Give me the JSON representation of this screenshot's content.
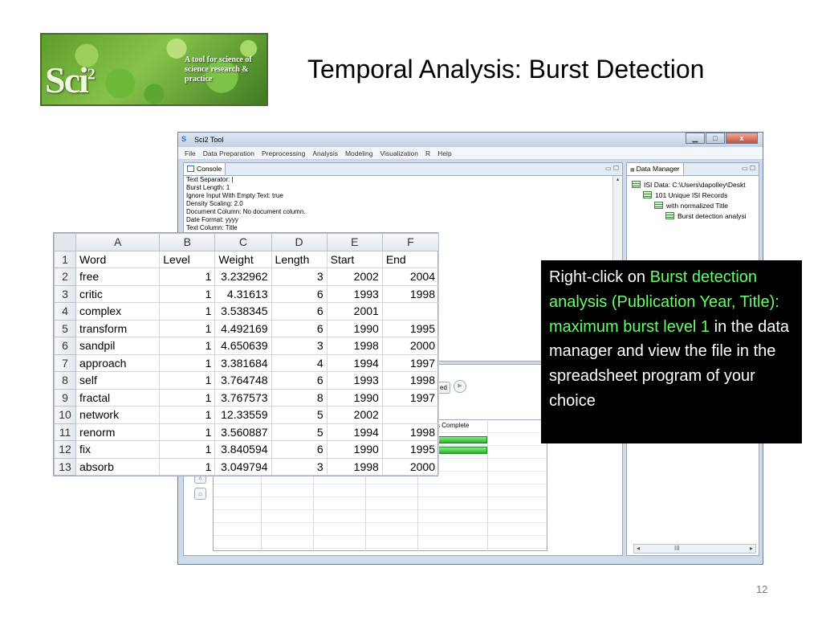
{
  "slide": {
    "title": "Temporal Analysis: Burst Detection",
    "page_number": "12"
  },
  "logo": {
    "mark": "Sci",
    "mark_sup": "2",
    "tagline": "A tool for science of science research & practice"
  },
  "window": {
    "title": "Sci2 Tool",
    "controls": [
      "▁",
      "□",
      "x"
    ],
    "menu": [
      "File",
      "Data Preparation",
      "Preprocessing",
      "Analysis",
      "Modeling",
      "Visualization",
      "R",
      "Help"
    ]
  },
  "console": {
    "tab_label": "Console",
    "lines": [
      "Text Separator: |",
      "Burst Length: 1",
      "Ignore Input With Empty Text: true",
      "Density Scaling: 2.0",
      "Document Column: No document column.",
      "Date Format: yyyy",
      "Text Column: Title"
    ]
  },
  "data_manager": {
    "tab_label": "Data Manager",
    "items": [
      {
        "label": "ISI Data: C:\\Users\\dapolley\\Deskt"
      },
      {
        "label": "101 Unique ISI Records"
      },
      {
        "label": "with normalized Title"
      },
      {
        "label": "Burst detection analysi"
      }
    ]
  },
  "scheduler": {
    "button_fragment": "ed",
    "column_header": "s Complete",
    "scroll_label": "III"
  },
  "spreadsheet": {
    "columns": [
      "A",
      "B",
      "C",
      "D",
      "E",
      "F"
    ],
    "rows": [
      [
        "Word",
        "Level",
        "Weight",
        "Length",
        "Start",
        "End"
      ],
      [
        "free",
        "1",
        "3.232962",
        "3",
        "2002",
        "2004"
      ],
      [
        "critic",
        "1",
        "4.31613",
        "6",
        "1993",
        "1998"
      ],
      [
        "complex",
        "1",
        "3.538345",
        "6",
        "2001",
        ""
      ],
      [
        "transform",
        "1",
        "4.492169",
        "6",
        "1990",
        "1995"
      ],
      [
        "sandpil",
        "1",
        "4.650639",
        "3",
        "1998",
        "2000"
      ],
      [
        "approach",
        "1",
        "3.381684",
        "4",
        "1994",
        "1997"
      ],
      [
        "self",
        "1",
        "3.764748",
        "6",
        "1993",
        "1998"
      ],
      [
        "fractal",
        "1",
        "3.767573",
        "8",
        "1990",
        "1997"
      ],
      [
        "network",
        "1",
        "12.33559",
        "5",
        "2002",
        ""
      ],
      [
        "renorm",
        "1",
        "3.560887",
        "5",
        "1994",
        "1998"
      ],
      [
        "fix",
        "1",
        "3.840594",
        "6",
        "1990",
        "1995"
      ],
      [
        "absorb",
        "1",
        "3.049794",
        "3",
        "1998",
        "2000"
      ]
    ]
  },
  "callout": {
    "p1": "Right-click on ",
    "p2": "Burst detection analysis (Publication Year, Title): maximum burst level 1",
    "p3": " in the data manager and view the file in the spreadsheet program of your choice"
  },
  "colors": {
    "callout_bg": "#000000",
    "callout_highlight": "#66ff66",
    "progress": "#23b523"
  }
}
